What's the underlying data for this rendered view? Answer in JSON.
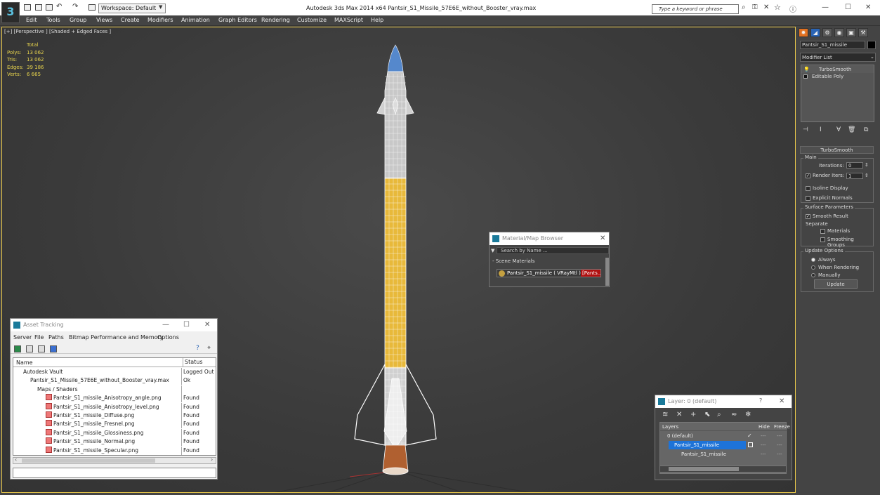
{
  "titlebar": {
    "workspace": "Workspace: Default",
    "app_title": "Autodesk 3ds Max  2014 x64       Pantsir_S1_Missile_57E6E_without_Booster_vray.max",
    "search_placeholder": "Type a keyword or phrase"
  },
  "menu": [
    "Edit",
    "Tools",
    "Group",
    "Views",
    "Create",
    "Modifiers",
    "Animation",
    "Graph Editors",
    "Rendering",
    "Customize",
    "MAXScript",
    "Help"
  ],
  "viewport": {
    "label": "[+] [Perspective ] [Shaded + Edged Faces ]",
    "stats": {
      "header": "Total",
      "rows": [
        {
          "k": "Polys:",
          "v": "13 062"
        },
        {
          "k": "Tris:",
          "v": "13 062"
        },
        {
          "k": "Edges:",
          "v": "39 186"
        },
        {
          "k": "Verts:",
          "v": "6 665"
        }
      ]
    }
  },
  "colors": {
    "accent": "#e9c84a",
    "missile_yellow": "#e8b93a",
    "tip_blue": "#5588cc",
    "nozzle": "#b06030",
    "selected": "#1e73d8",
    "tag_red": "#b01010"
  },
  "command_panel": {
    "object_name": "Pantsir_S1_missile",
    "modifier_list": "Modifier List",
    "stack": [
      "TurboSmooth",
      "Editable Poly"
    ],
    "rollout_title": "TurboSmooth",
    "main_group": "Main",
    "iterations_label": "Iterations:",
    "iterations_value": "0",
    "render_iters_label": "Render Iters:",
    "render_iters_value": "1",
    "isoline": "Isoline Display",
    "explicit": "Explicit Normals",
    "surface_group": "Surface Parameters",
    "smooth_result": "Smooth Result",
    "separate": "Separate",
    "materials": "Materials",
    "smoothing_groups": "Smoothing Groups",
    "update_group": "Update Options",
    "always": "Always",
    "when_rendering": "When Rendering",
    "manually": "Manually",
    "update_btn": "Update"
  },
  "material_browser": {
    "title": "Material/Map Browser",
    "search": "Search by Name ...",
    "section": "- Scene Materials",
    "item": "Pantsir_S1_missile  ( VRayMtl )  [Pants...",
    "tag": "[Pants..."
  },
  "asset_tracking": {
    "title": "Asset Tracking",
    "menu": [
      "Server",
      "File",
      "Paths",
      "Bitmap Performance and Memory",
      "Options"
    ],
    "columns": [
      "Name",
      "Status"
    ],
    "rows": [
      {
        "name": "Autodesk Vault",
        "status": "Logged Out ..."
      },
      {
        "name": "Pantsir_S1_Missile_57E6E_without_Booster_vray.max",
        "status": "Ok"
      },
      {
        "name": "Maps / Shaders",
        "status": ""
      },
      {
        "name": "Pantsir_S1_missile_Anisotropy_angle.png",
        "status": "Found"
      },
      {
        "name": "Pantsir_S1_missile_Anisotropy_level.png",
        "status": "Found"
      },
      {
        "name": "Pantsir_S1_missile_Diffuse.png",
        "status": "Found"
      },
      {
        "name": "Pantsir_S1_missile_Fresnel.png",
        "status": "Found"
      },
      {
        "name": "Pantsir_S1_missile_Glossiness.png",
        "status": "Found"
      },
      {
        "name": "Pantsir_S1_missile_Normal.png",
        "status": "Found"
      },
      {
        "name": "Pantsir_S1_missile_Specular.png",
        "status": "Found"
      }
    ]
  },
  "layers": {
    "title": "Layer: 0 (default)",
    "help": "?",
    "columns": [
      "Layers",
      "Hide",
      "Freeze"
    ],
    "rows": [
      {
        "name": "0 (default)"
      },
      {
        "name": "Pantsir_S1_missile"
      },
      {
        "name": "Pantsir_S1_missile"
      }
    ]
  }
}
